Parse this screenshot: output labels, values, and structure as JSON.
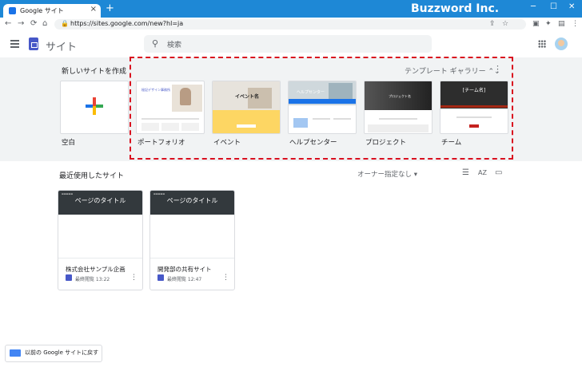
{
  "browser": {
    "tab_title": "Google サイト",
    "tab_close": "×",
    "new_tab": "+",
    "brand": "Buzzword Inc.",
    "window_buttons": [
      "─",
      "☐",
      "✕"
    ],
    "url": "https://sites.google.com/new?hl=ja",
    "nav": [
      "←",
      "→",
      "⟳",
      "⌂"
    ],
    "toolbar_icons": [
      "⇪",
      "☆",
      "▣",
      "✦",
      "▤",
      "⋮"
    ]
  },
  "header": {
    "app_title": "サイト",
    "search_placeholder": "検索",
    "search_icon": "🔍"
  },
  "create": {
    "title": "新しいサイトを作成",
    "gallery_label": "テンプレート ギャラリー ⌃⌄",
    "more": "⋮",
    "templates": [
      {
        "label": "空白",
        "icon": "plus-icon"
      },
      {
        "label": "ポートフォリオ",
        "preview_text": "秘記デザイン事務所"
      },
      {
        "label": "イベント",
        "preview_text": "イベント名"
      },
      {
        "label": "ヘルプセンター",
        "preview_text": "ヘルプセンター"
      },
      {
        "label": "プロジェクト",
        "preview_text": "プロジェクト名"
      },
      {
        "label": "チーム",
        "preview_text": "[チーム名]"
      }
    ]
  },
  "recent": {
    "title": "最近使用したサイト",
    "owner_filter": "オーナー指定なし ▾",
    "view_icons": [
      "☰",
      "AZ",
      "▭"
    ],
    "cards": [
      {
        "head": "ページのタイトル",
        "name": "株式会社サンプル企画",
        "meta": "最終閲覧 13:22"
      },
      {
        "head": "ページのタイトル",
        "name": "開発部の共有サイト",
        "meta": "最終閲覧 12:47"
      }
    ]
  },
  "footer": {
    "classic_label": "以前の Google サイトに戻す"
  },
  "colors": {
    "titlebar": "#1e88d6",
    "highlight": "#d9101f",
    "sites_brand": "#4758c8"
  }
}
